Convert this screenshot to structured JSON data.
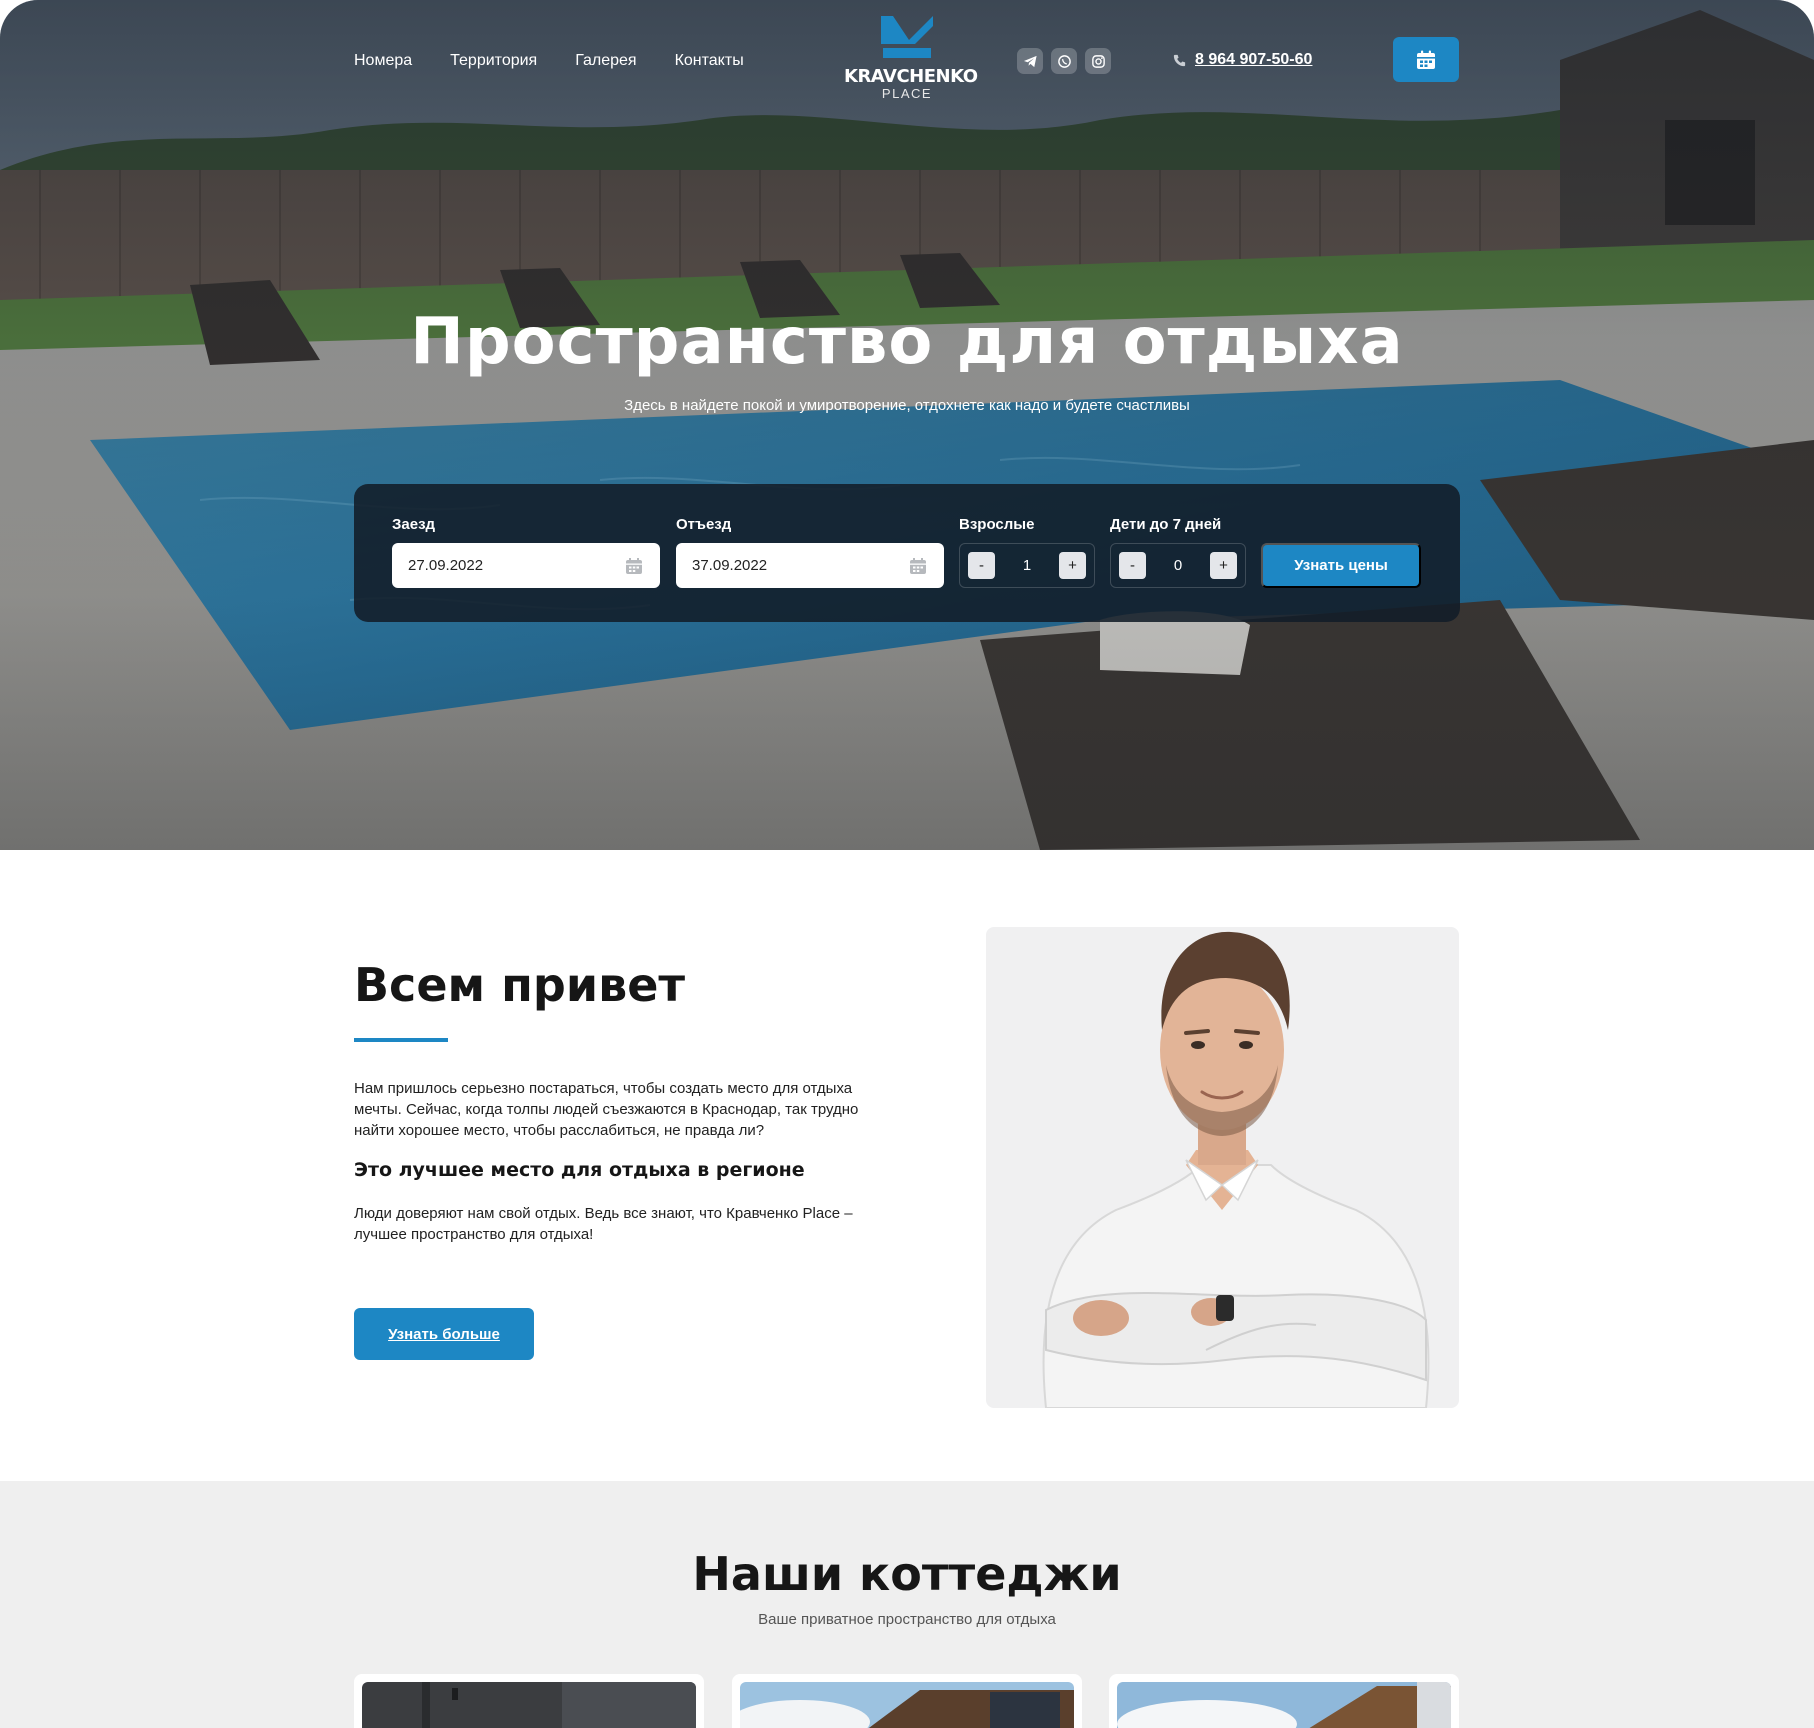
{
  "header": {
    "nav": [
      "Номера",
      "Территория",
      "Галерея",
      "Контакты"
    ],
    "logo_name": "KRAVCHENKO",
    "logo_sub": "PLACE",
    "socials": [
      "telegram-icon",
      "whatsapp-icon",
      "instagram-icon"
    ],
    "phone": "8 964 907-50-60"
  },
  "hero": {
    "title": "Пространство для отдыха",
    "subtitle": "Здесь в найдете покой и умиротворение, отдохнете как надо и будете счастливы"
  },
  "booking": {
    "checkin_label": "Заезд",
    "checkin_value": "27.09.2022",
    "checkout_label": "Отъезд",
    "checkout_value": "37.09.2022",
    "adults_label": "Взрослые",
    "adults_value": "1",
    "kids_label": "Дети до 7 дней",
    "kids_value": "0",
    "minus": "-",
    "plus": "+",
    "submit": "Узнать цены"
  },
  "about": {
    "title": "Всем привет",
    "paragraph1": "Нам пришлось серьезно постараться, чтобы создать место для отдыха мечты. Сейчас, когда толпы людей съезжаются в Краснодар, так трудно найти хорошее место, чтобы расслабиться, не правда ли?",
    "subtitle": "Это лучшее место для отдыха в регионе",
    "paragraph2": "Люди доверяют нам свой отдых. Ведь все знают, что Кравченко Place – лучшее пространство для отдыха!",
    "button": "Узнать больше"
  },
  "cottages": {
    "title": "Наши коттеджи",
    "subtitle": "Ваше приватное пространство для отдыха"
  },
  "colors": {
    "accent": "#1d87c4",
    "booking_panel": "#121c28",
    "section_bg": "#efefef"
  }
}
